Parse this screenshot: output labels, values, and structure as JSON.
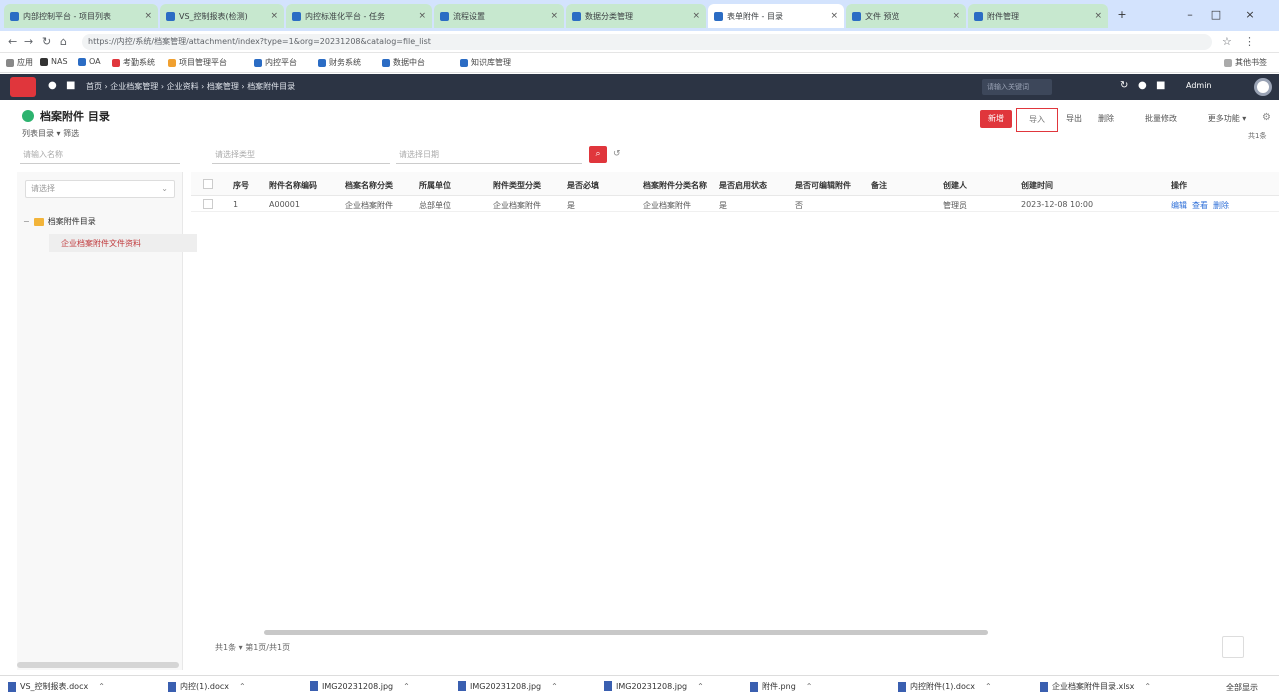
{
  "browser": {
    "tabs": [
      {
        "title": "内部控制平台 - 项目列表",
        "active": false
      },
      {
        "title": "VS_控制报表(检测)",
        "active": false
      },
      {
        "title": "内控标准化平台 - 任务",
        "active": false
      },
      {
        "title": "流程设置",
        "active": false
      },
      {
        "title": "数据分类管理",
        "active": false
      },
      {
        "title": "表单附件 - 目录",
        "active": true
      },
      {
        "title": "文件 预览",
        "active": false
      },
      {
        "title": "附件管理",
        "active": false
      }
    ],
    "url": "https://内控/系统/档案管理/attachment/index?type=1&org=20231208&catalog=file_list",
    "bookmarks": [
      "应用",
      "NAS",
      "OA",
      "考勤系统",
      "项目管理平台",
      "内控平台",
      "财务系统",
      "数据中台",
      "知识库管理",
      "其他书签"
    ]
  },
  "appnav": {
    "breadcrumbs": [
      "首页",
      "企业档案管理",
      "企业资料",
      "档案管理",
      "档案附件目录"
    ],
    "search_placeholder": "请输入关键词",
    "user": "Admin"
  },
  "page": {
    "title": "档案附件 目录",
    "sub": "列表目录 ▾  筛选",
    "buttons": [
      "新增",
      "导入",
      "导出",
      "删除",
      "批量修改",
      "更多功能 ▾"
    ],
    "count": "共1条",
    "filters": [
      "请输入名称",
      "请选择类型",
      "请选择日期"
    ]
  },
  "tree": {
    "search": "请选择",
    "root": "档案附件目录",
    "child": "企业档案附件文件资料"
  },
  "table": {
    "headers": [
      "序号",
      "附件名称编码",
      "档案名称分类",
      "所属单位",
      "附件类型分类",
      "是否必填",
      "档案附件分类名称",
      "是否启用状态",
      "是否可编辑附件",
      "备注",
      "创建人",
      "创建时间",
      "操作"
    ],
    "rows": [
      {
        "cells": [
          "1",
          "A00001",
          "企业档案附件",
          "总部单位",
          "企业档案附件",
          "是",
          "企业档案附件",
          "是",
          "否",
          "",
          "管理员",
          "2023-12-08 10:00"
        ],
        "actions": [
          "编辑",
          "查看",
          "删除"
        ]
      }
    ]
  },
  "pager": "共1条  ▾  第1页/共1页",
  "downloads": {
    "items": [
      "VS_控制报表.docx",
      "内控(1).docx",
      "IMG20231208.jpg",
      "IMG20231208.jpg",
      "IMG20231208.jpg",
      "附件.png",
      "内控附件(1).docx",
      "企业档案附件目录.xlsx"
    ],
    "show_all": "全部显示"
  },
  "colors": {
    "accent": "#e0363c",
    "nav": "#2c3444",
    "link": "#2e6fd8",
    "success": "#2db36f"
  }
}
